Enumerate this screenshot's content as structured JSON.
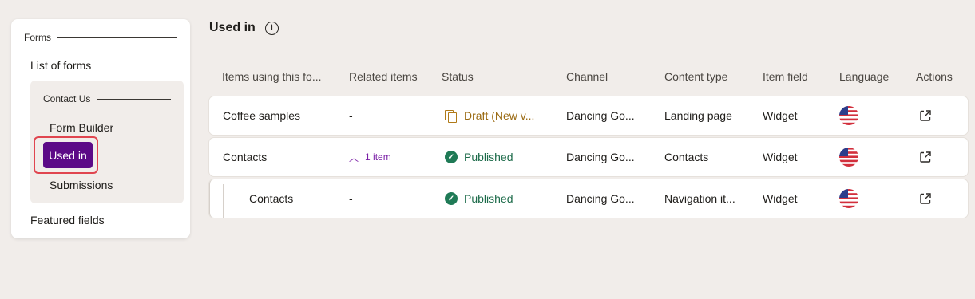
{
  "sidebar": {
    "section_label": "Forms",
    "list_label": "List of forms",
    "group_label": "Contact Us",
    "items": [
      {
        "label": "Form Builder"
      },
      {
        "label": "Used in"
      },
      {
        "label": "Submissions"
      }
    ],
    "featured_label": "Featured fields"
  },
  "header": {
    "title": "Used in",
    "info_icon": "info-icon"
  },
  "table": {
    "columns": [
      "Items using this fo...",
      "Related items",
      "Status",
      "Channel",
      "Content type",
      "Item field",
      "Language",
      "Actions"
    ],
    "rows": [
      {
        "name": "Coffee samples",
        "related": "-",
        "status": "Draft (New v...",
        "status_type": "draft",
        "channel": "Dancing Go...",
        "content_type": "Landing page",
        "item_field": "Widget",
        "language_icon": "us-flag-icon",
        "action_icon": "open-external-icon"
      },
      {
        "name": "Contacts",
        "related": "1 item",
        "status": "Published",
        "status_type": "published",
        "channel": "Dancing Go...",
        "content_type": "Contacts",
        "item_field": "Widget",
        "language_icon": "us-flag-icon",
        "action_icon": "open-external-icon"
      },
      {
        "name": "Contacts",
        "related": "-",
        "status": "Published",
        "status_type": "published",
        "channel": "Dancing Go...",
        "content_type": "Navigation it...",
        "item_field": "Widget",
        "language_icon": "us-flag-icon",
        "action_icon": "open-external-icon"
      }
    ]
  },
  "colors": {
    "accent": "#5c0a87",
    "highlight_outline": "#e0454f",
    "draft": "#9a6a12",
    "published": "#1f7a56",
    "background": "#f1edea"
  }
}
